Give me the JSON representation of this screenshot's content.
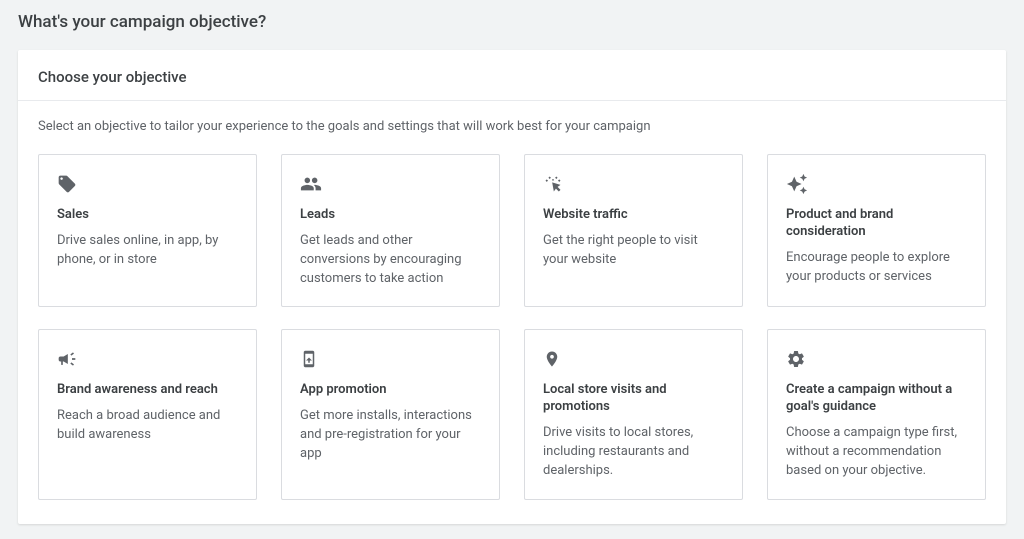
{
  "page": {
    "title": "What's your campaign objective?"
  },
  "panel": {
    "heading": "Choose your objective",
    "helpText": "Select an objective to tailor your experience to the goals and settings that will work best for your campaign"
  },
  "objectives": [
    {
      "icon": "tag-icon",
      "title": "Sales",
      "description": "Drive sales online, in app, by phone, or in store"
    },
    {
      "icon": "people-icon",
      "title": "Leads",
      "description": "Get leads and other conversions by encouraging customers to take action"
    },
    {
      "icon": "click-icon",
      "title": "Website traffic",
      "description": "Get the right people to visit your website"
    },
    {
      "icon": "sparkle-icon",
      "title": "Product and brand consideration",
      "description": "Encourage people to explore your products or services"
    },
    {
      "icon": "megaphone-icon",
      "title": "Brand awareness and reach",
      "description": "Reach a broad audience and build awareness"
    },
    {
      "icon": "phone-app-icon",
      "title": "App promotion",
      "description": "Get more installs, interactions and pre-registration for your app"
    },
    {
      "icon": "location-pin-icon",
      "title": "Local store visits and promotions",
      "description": "Drive visits to local stores, including restaurants and dealerships."
    },
    {
      "icon": "gear-icon",
      "title": "Create a campaign without a goal's guidance",
      "description": "Choose a campaign type first, without a recommendation based on your objective."
    }
  ]
}
